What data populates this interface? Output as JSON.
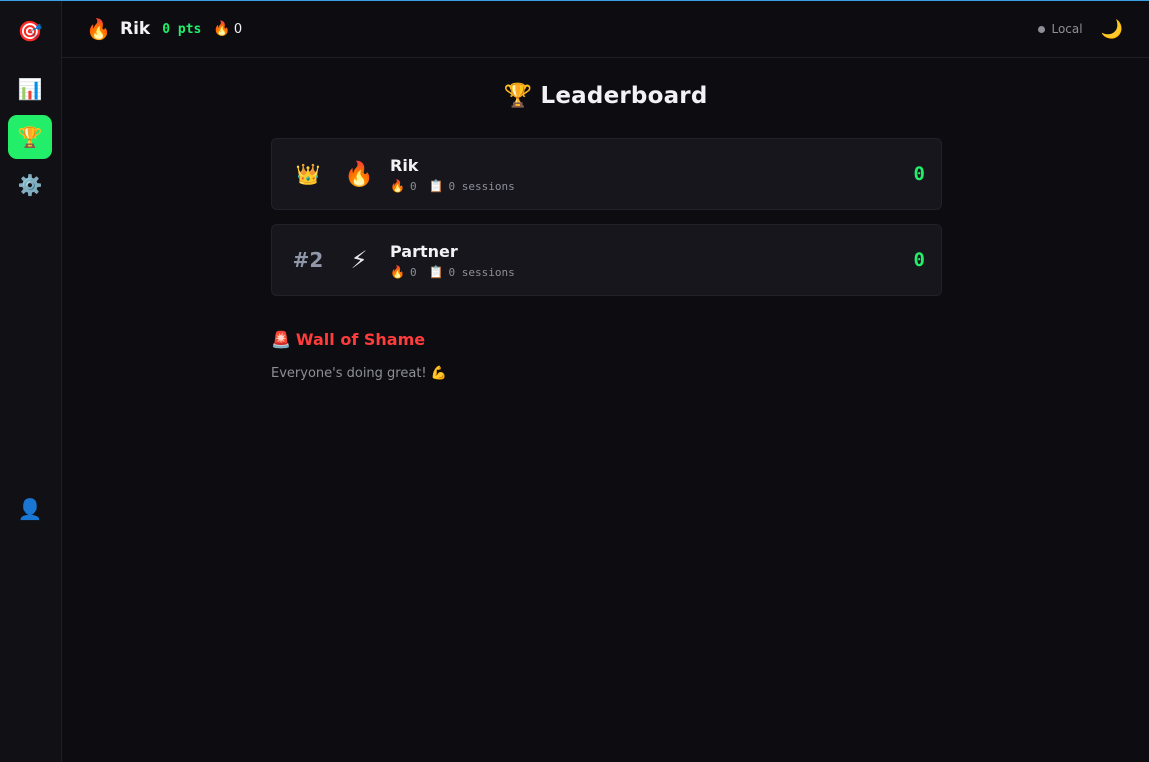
{
  "sidebar": {
    "items": [
      {
        "id": "logo",
        "icon": "🎯",
        "icon_name": "target-icon"
      },
      {
        "id": "stats",
        "icon": "📊",
        "icon_name": "bar-chart-icon"
      },
      {
        "id": "leaderboard",
        "icon": "🏆",
        "icon_name": "trophy-icon",
        "active": true
      },
      {
        "id": "settings",
        "icon": "⚙️",
        "icon_name": "gear-icon"
      },
      {
        "id": "profile",
        "icon": "👤",
        "icon_name": "user-icon"
      }
    ]
  },
  "header": {
    "user_icon": "🔥",
    "user_name": "Rik",
    "points": "0 pts",
    "streak_icon": "🔥",
    "streak": "0",
    "sync_status": "Local",
    "theme_icon": "🌙"
  },
  "main": {
    "title": "🏆 Leaderboard",
    "players": [
      {
        "rank": "👑",
        "avatar": "🔥",
        "name": "Rik",
        "streak_icon": "🔥",
        "streak": "0",
        "sessions_icon": "📋",
        "sessions": "0 sessions",
        "score": "0"
      },
      {
        "rank": "#2",
        "avatar": "⚡",
        "name": "Partner",
        "streak_icon": "🔥",
        "streak": "0",
        "sessions_icon": "📋",
        "sessions": "0 sessions",
        "score": "0"
      }
    ],
    "shame": {
      "icon": "🚨",
      "title": "Wall of Shame",
      "empty_text": "Everyone's doing great! 💪"
    }
  },
  "colors": {
    "accent": "#22ee6a",
    "shame": "#ff3b3b",
    "background": "#0d0d11"
  }
}
